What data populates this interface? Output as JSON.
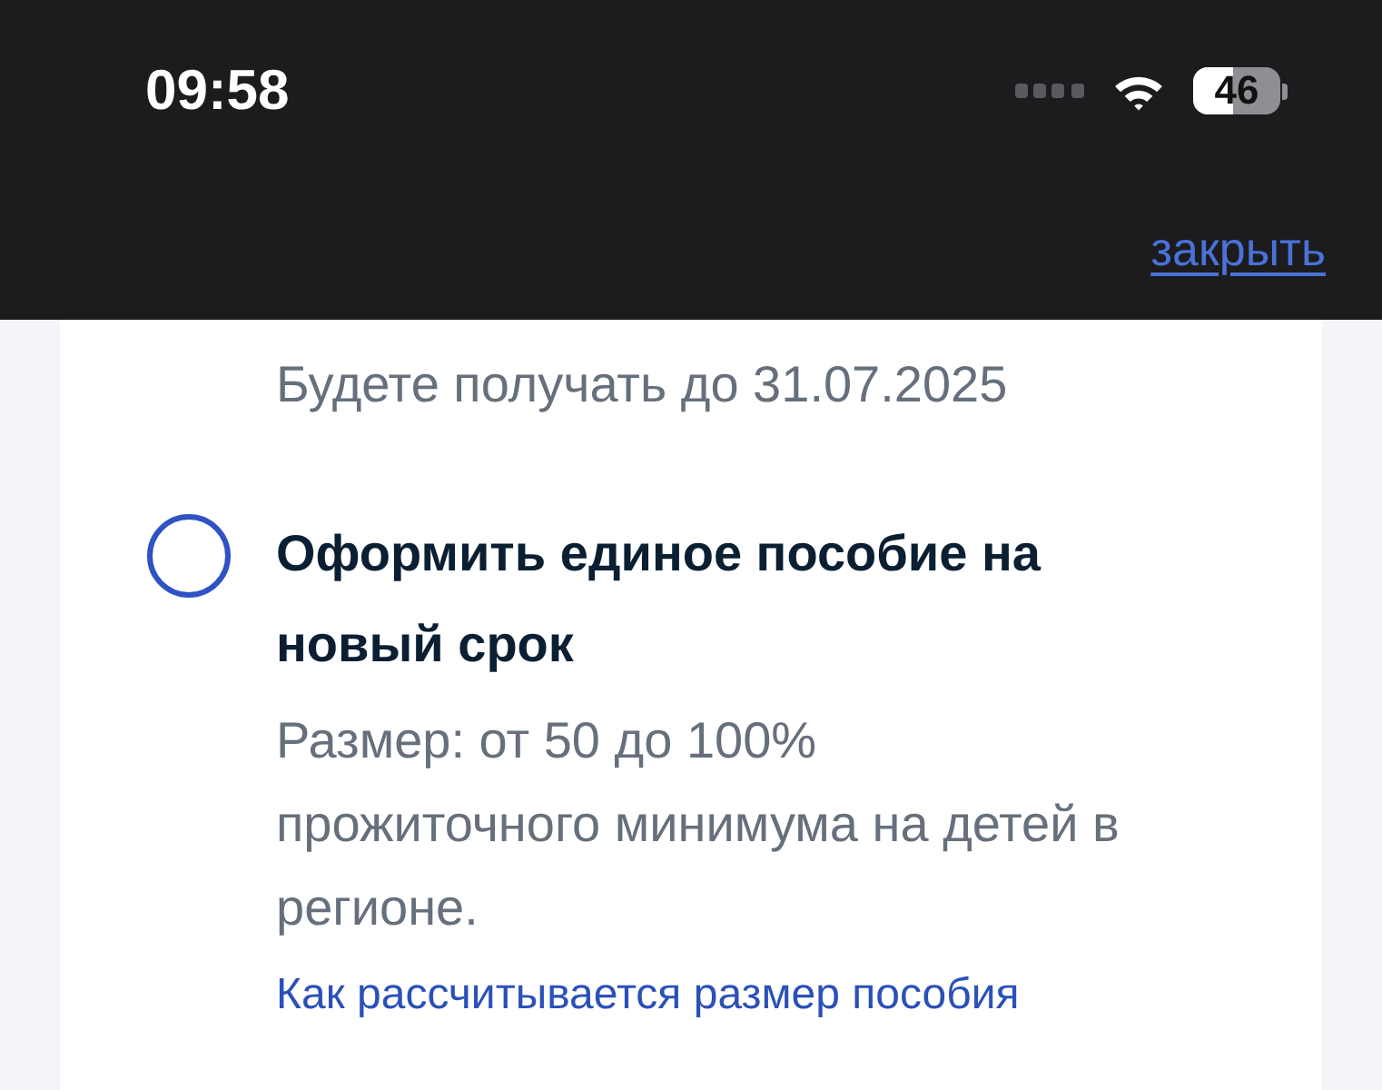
{
  "status_bar": {
    "time": "09:58",
    "battery": "46"
  },
  "header": {
    "close_link": "закрыть"
  },
  "card": {
    "previous_option_tail": "Будете получать до 31.07.2025",
    "option": {
      "selected": false,
      "title": "Оформить единое пособие на новый срок",
      "description": "Размер: от 50 до 100% прожиточного минимума на детей в регионе.",
      "link": "Как рассчитывается размер пособия"
    }
  }
}
